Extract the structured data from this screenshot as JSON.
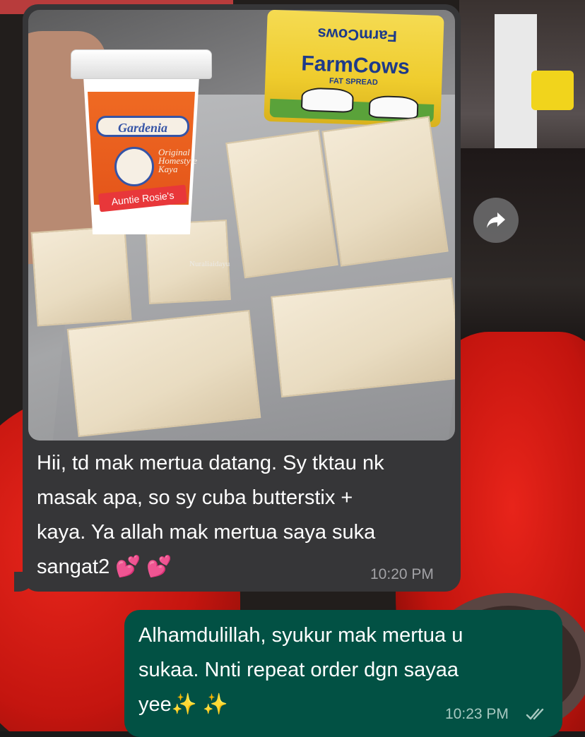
{
  "chat": {
    "incoming": {
      "photo": {
        "cup_brand": "Gardenia",
        "cup_side_text": "Original Homestyle Kaya",
        "cup_ribbon": "Auntie Rosie's",
        "butter_top_text": "FarmCows",
        "butter_name": "FarmCows",
        "butter_sub": "FAT SPREAD",
        "watermark": "Nuraliaidayu"
      },
      "text": "Hii, td mak mertua datang. Sy tktau nk\nmasak apa, so sy cuba butterstix +\nkaya. Ya allah mak mertua saya suka\nsangat2 💕 💕",
      "time": "10:20 PM"
    },
    "outgoing": {
      "text": "Alhamdulillah, syukur mak mertua u\nsukaa. Nnti repeat order dgn sayaa\nyee✨ ✨",
      "time": "10:23 PM",
      "status_icon": "double-check-icon"
    },
    "forward_icon": "forward-arrow-icon",
    "colors": {
      "incoming_bubble": "#363638",
      "outgoing_bubble": "#025144",
      "incoming_time": "#a2a2a6",
      "outgoing_time": "#a7c8c0"
    }
  }
}
